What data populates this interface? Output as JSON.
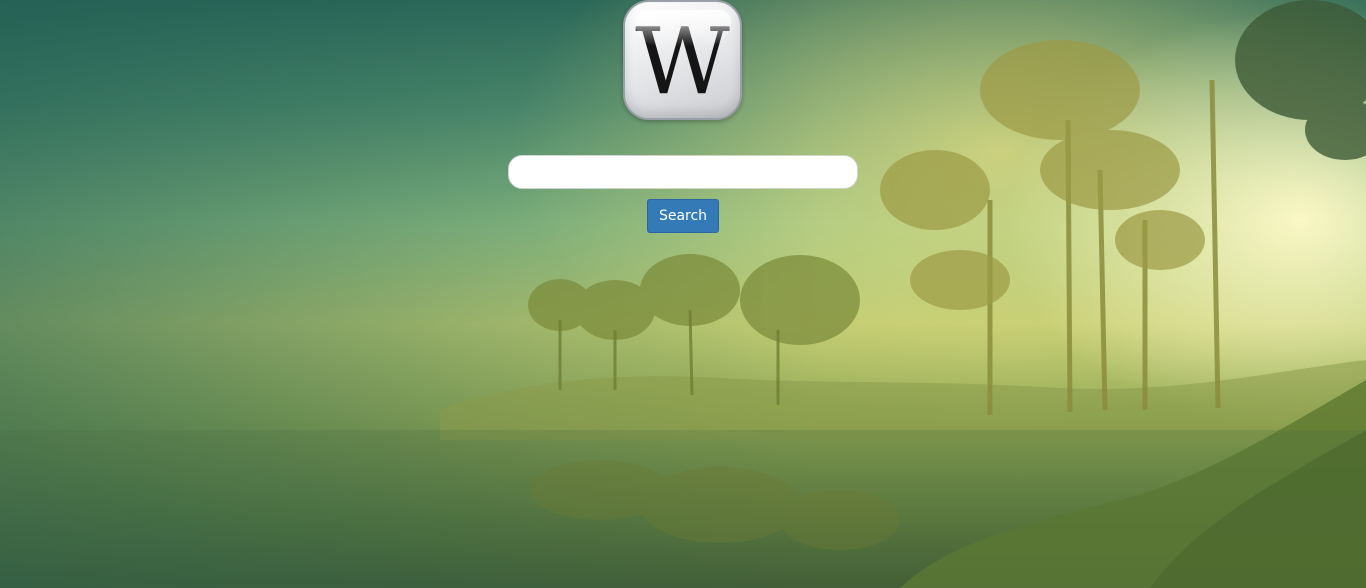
{
  "logo": {
    "letter": "W",
    "icon": "wikipedia-logo-icon"
  },
  "search": {
    "value": "",
    "placeholder": ""
  },
  "search_button": {
    "label": "Search",
    "color": "#337ab7"
  }
}
